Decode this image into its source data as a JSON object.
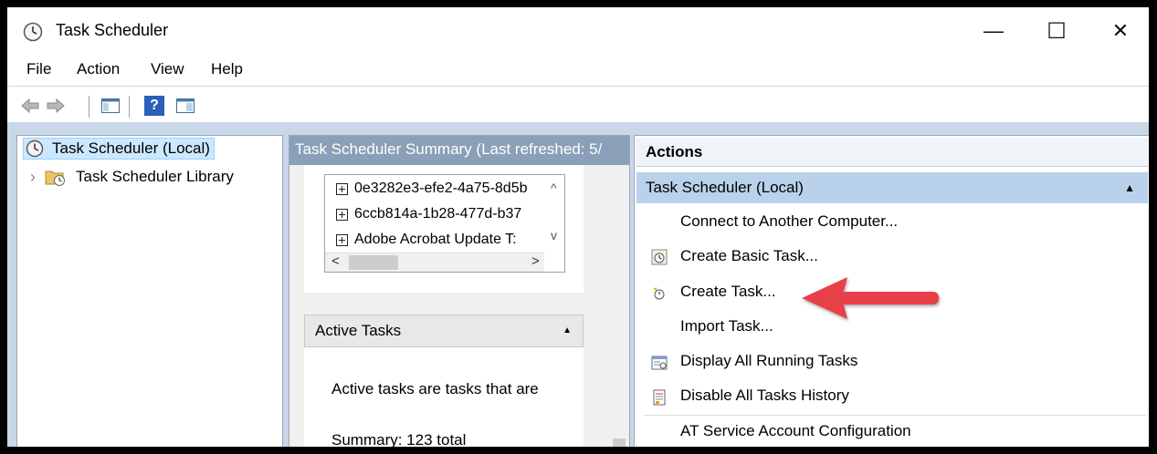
{
  "window": {
    "title": "Task Scheduler",
    "minimize_glyph": "—",
    "maximize_glyph": "☐",
    "close_glyph": "✕"
  },
  "menu": [
    "File",
    "Action",
    "View",
    "Help"
  ],
  "toolbar": {
    "icons": [
      "back-arrow-icon",
      "forward-arrow-icon",
      "show-hide-console-tree-icon",
      "help-icon",
      "show-hide-action-pane-icon"
    ],
    "help_glyph": "?"
  },
  "tree": {
    "root": "Task Scheduler (Local)",
    "library": "Task Scheduler Library",
    "expand_glyph": "›"
  },
  "summary": {
    "header": "Task Scheduler Summary (Last refreshed: 5/",
    "list_items": [
      "0e3282e3-efe2-4a75-8d5b",
      "6ccb814a-1b28-477d-b37",
      "Adobe Acrobat Update T:"
    ],
    "scroll_glyphs": {
      "up": "^",
      "down": "v",
      "left": "<",
      "right": ">"
    },
    "active_tasks": {
      "header": "Active Tasks",
      "collapse_glyph": "▲",
      "description": "Active tasks are tasks that are",
      "summary": "Summary: 123 total"
    }
  },
  "actions": {
    "header": "Actions",
    "section": "Task Scheduler (Local)",
    "section_glyph": "▲",
    "items": [
      "Connect to Another Computer...",
      "Create Basic Task...",
      "Create Task...",
      "Import Task...",
      "Display All Running Tasks",
      "Disable All Tasks History",
      "AT Service Account Configuration"
    ]
  },
  "annotation": {
    "arrow_color": "#e8414a",
    "points_to": "Create Task..."
  }
}
